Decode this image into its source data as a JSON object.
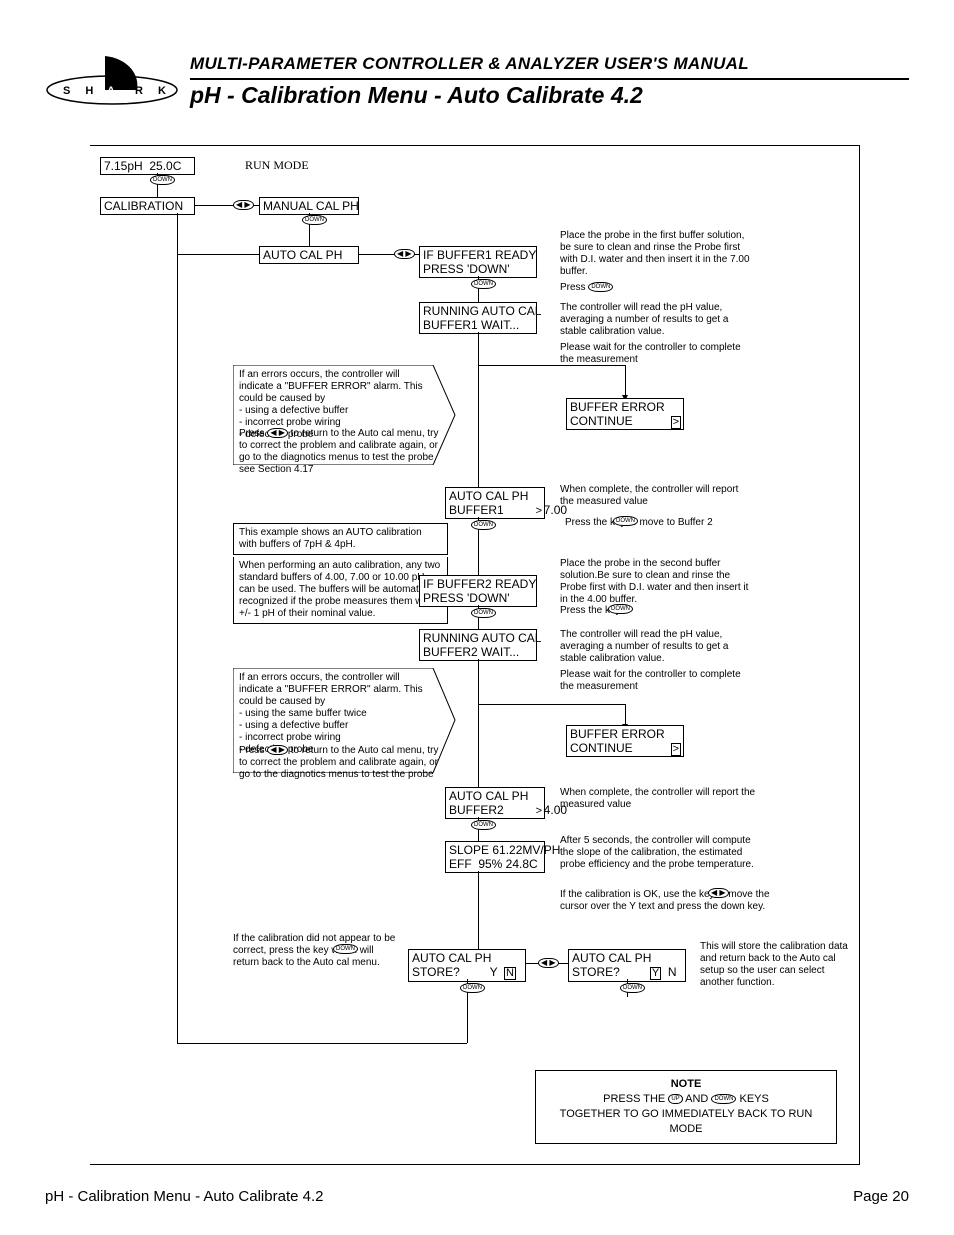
{
  "header": {
    "manual_title": "MULTI-PARAMETER CONTROLLER & ANALYZER USER'S MANUAL",
    "section_title": "pH - Calibration Menu - Auto Calibrate 4.2",
    "logo_letters": "S H A R K"
  },
  "screens": {
    "run_mode_display": "7.15pH  25.0C",
    "run_mode_label": "RUN MODE",
    "calibration": "CALIBRATION",
    "manual_cal_ph": "MANUAL CAL PH",
    "auto_cal_ph": "AUTO CAL PH",
    "if_buffer1_ready": "IF BUFFER1 READY\nPRESS 'DOWN'",
    "running_buffer1": "RUNNING AUTO CAL\nBUFFER1 WAIT...",
    "buffer_error1": "BUFFER ERROR\nCONTINUE",
    "auto_cal_buffer1_val": "AUTO CAL PH\nBUFFER1            7.00",
    "if_buffer2_ready": "IF BUFFER2 READY\nPRESS 'DOWN'",
    "running_buffer2": "RUNNING AUTO CAL\nBUFFER2 WAIT...",
    "buffer_error2": "BUFFER ERROR\nCONTINUE",
    "auto_cal_buffer2_val": "AUTO CAL PH\nBUFFER2            4.00",
    "slope": "SLOPE 61.22MV/PH\nEFF  95% 24.8C",
    "store_yn_left": "AUTO CAL PH\nSTORE?            Y  N",
    "store_yn_right": "AUTO CAL PH\nSTORE?            Y  N"
  },
  "key_labels": {
    "down": "DOWN",
    "up": "UP",
    "lr": "◀ ▶"
  },
  "explanations": {
    "error1": "If an errors occurs, the controller will indicate a \"BUFFER ERROR\" alarm. This could be caused by\n- using a defective buffer\n- incorrect probe wiring\n- defective probe",
    "error1b": "to return to the Auto cal menu, try to correct the problem and calibrate again, or go to the diagnotics menus to test the probe\nsee Section 4.17",
    "example_note": "This example shows an AUTO calibration with buffers of 7pH & 4pH.",
    "any_two": "When performing an auto calibration, any two standard buffers of 4.00, 7.00 or 10.00 pH can be used. The buffers will be automatically recognized if the probe measures them within +/- 1 pH of their nominal value.",
    "error2": "If an errors occurs, the controller will indicate a \"BUFFER ERROR\" alarm. This could be caused by\n- using the same buffer twice\n- using a defective buffer\n- incorrect probe wiring\n- defective probe",
    "error2b": "to return to the Auto cal menu, try to correct the problem and calibrate again, or go to the diagnotics menus to test the probe",
    "place1": "Place the probe in the first buffer solution, be sure to clean and rinse the Probe first with D.I. water and then insert it in the 7.00 buffer.",
    "press_down_1": "Press",
    "read_avg": "The controller will read the pH value, averaging a number of results to get a stable calibration value.",
    "wait1": "Please wait for the controller to complete the measurement",
    "complete1": "When complete, the controller will report the measured value",
    "press_move_b2": "Press the            key to move to Buffer 2",
    "place2": "Place the probe in the second buffer solution.Be sure to clean and rinse the Probe first with D.I. water and then insert it in the 4.00 buffer.",
    "press_down_2": "Press the            key",
    "read_avg2": "The controller will read the pH value, averaging a number of results to get a stable calibration value.",
    "wait2": "Please wait for the controller to complete the measurement",
    "complete2": "When complete, the controller will report the measured value",
    "after5": "After 5 seconds, the controller will compute the slope of the calibration, the estimated probe efficiency and the probe temperature.",
    "cal_ok": "If the calibration is OK, use the           key to move the cursor over the Y text and press the down key.",
    "not_correct": "If the calibration did not appear to be correct, press the           key which will return back to the Auto cal menu.",
    "store_note": "This will store the calibration data and return back to the Auto cal  setup so the user can select another function."
  },
  "final_note": {
    "title": "NOTE",
    "body_a": "PRESS THE",
    "body_b": "AND",
    "body_c": "KEYS",
    "body_d": "TOGETHER TO GO IMMEDIATELY BACK TO RUN MODE"
  },
  "footer": {
    "left": "pH - Calibration Menu - Auto Calibrate 4.2",
    "right": "Page 20"
  }
}
